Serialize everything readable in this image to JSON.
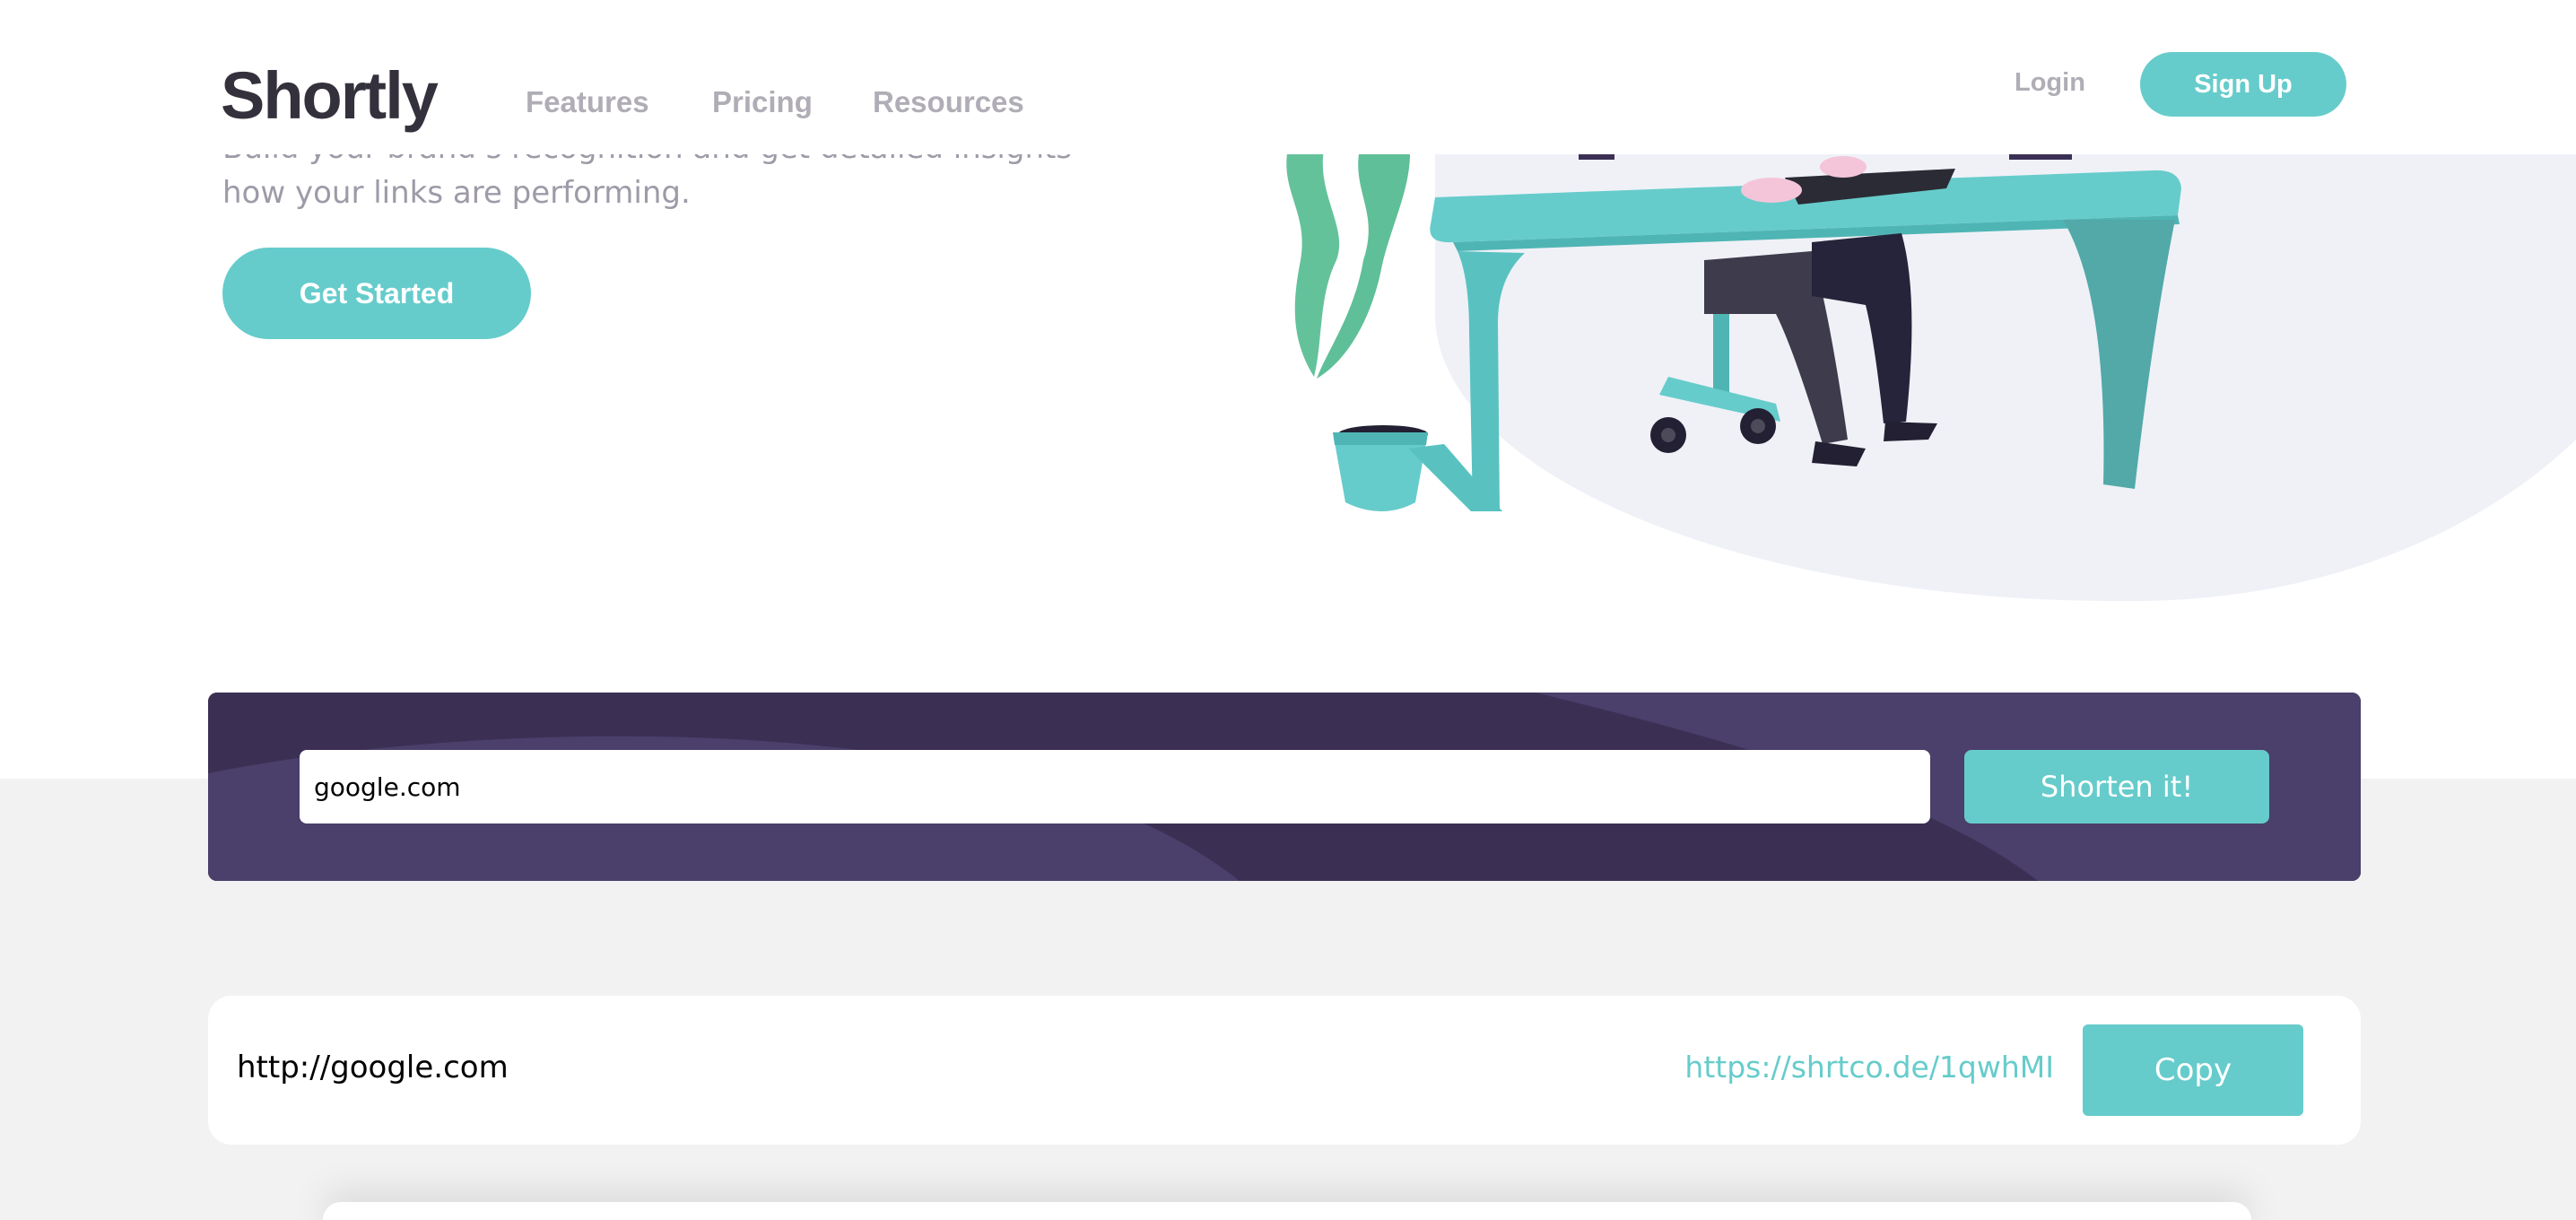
{
  "header": {
    "logo": "Shortly",
    "nav": [
      "Features",
      "Pricing",
      "Resources"
    ],
    "login_label": "Login",
    "signup_label": "Sign Up"
  },
  "hero": {
    "text_line1": "Build your brand’s recognition and get detailed insights on",
    "text_line2": "how your links are performing.",
    "cta_label": "Get Started",
    "illustration_icon": "person-working-at-desk-illustration"
  },
  "shorten": {
    "input_value": "google.com",
    "button_label": "Shorten it!"
  },
  "results": [
    {
      "original": "http://google.com",
      "short": "https://shrtco.de/1qwhMI",
      "copy_label": "Copy"
    }
  ],
  "colors": {
    "accent": "#66cccb",
    "dark_violet": "#3b3054",
    "grayish_violet": "#9e9aa7",
    "very_dark_blue": "#34313d",
    "light_gray": "#f2f2f2"
  }
}
